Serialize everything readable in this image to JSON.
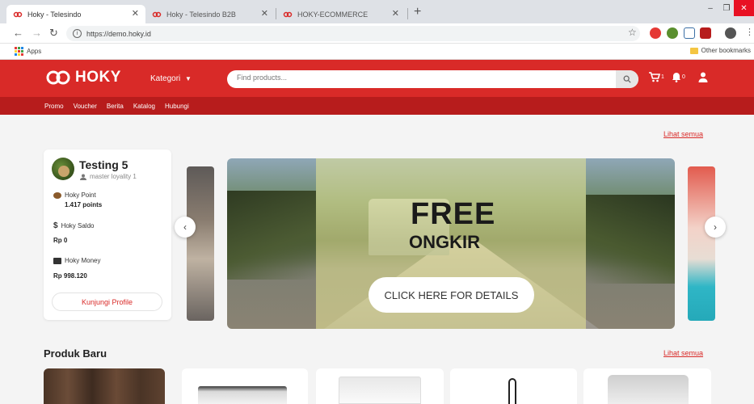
{
  "browser": {
    "tabs": [
      {
        "title": "Hoky - Telesindo",
        "active": true
      },
      {
        "title": "Hoky - Telesindo B2B",
        "active": false
      },
      {
        "title": "HOKY-ECOMMERCE",
        "active": false
      }
    ],
    "new_tab": "+",
    "url": "https://demo.hoky.id",
    "bookmarks": {
      "apps": "Apps",
      "other": "Other bookmarks"
    },
    "colors": {
      "tabbar": "#dee1e6",
      "close": "#e81123"
    }
  },
  "header": {
    "logo_text": "HOKY",
    "kategori": "Kategori",
    "search_placeholder": "Find products...",
    "cart_count": "1",
    "notif_count": "0",
    "nav": [
      "Promo",
      "Voucher",
      "Berita",
      "Katalog",
      "Hubungi"
    ],
    "colors": {
      "primary": "#d92a28",
      "nav": "#b71c1c"
    }
  },
  "main": {
    "top_link": "Lihat semua",
    "profile": {
      "name": "Testing 5",
      "level": "master loyality 1",
      "point_label": "Hoky Point",
      "point_value": "1.417 points",
      "saldo_label": "Hoky Saldo",
      "saldo_value": "Rp 0",
      "money_label": "Hoky Money",
      "money_value": "Rp 998.120",
      "visit_button": "Kunjungi Profile"
    },
    "banner": {
      "headline": "FREE",
      "subheadline": "ONGKIR",
      "cta": "CLICK HERE FOR DETAILS"
    },
    "new_products": {
      "title": "Produk Baru",
      "link": "Lihat semua"
    }
  }
}
